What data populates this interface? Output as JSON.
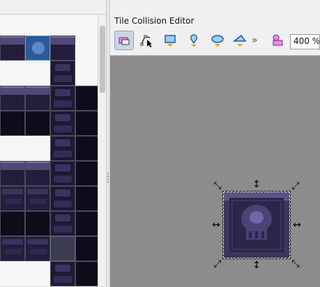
{
  "panel": {
    "title": "Tile Collision Editor"
  },
  "toolbar": {
    "tools": [
      {
        "name": "select-objects-tool",
        "icon": "select-objects-icon",
        "active": true
      },
      {
        "name": "edit-polygons-tool",
        "icon": "edit-polygons-icon",
        "active": false
      },
      {
        "name": "insert-rectangle-tool",
        "icon": "rectangle-icon",
        "active": false
      },
      {
        "name": "insert-point-tool",
        "icon": "point-icon",
        "active": false
      },
      {
        "name": "insert-ellipse-tool",
        "icon": "ellipse-icon",
        "active": false
      },
      {
        "name": "insert-polygon-tool",
        "icon": "polygon-icon",
        "active": false
      },
      {
        "name": "insert-template-tool",
        "icon": "template-icon",
        "active": false
      }
    ],
    "overflow_label": "»",
    "zoom_value": "400 %"
  },
  "colors": {
    "accent": "#f0a000",
    "selection": "#2a5a9a",
    "canvas": "#8c8c8c"
  }
}
